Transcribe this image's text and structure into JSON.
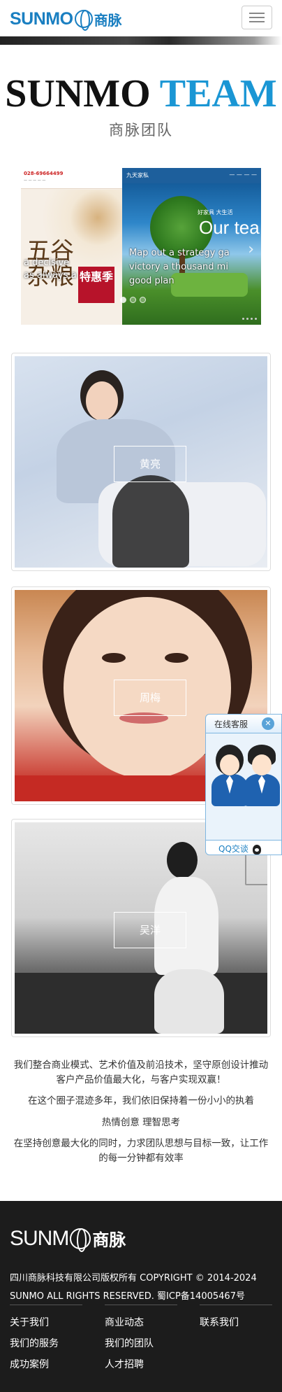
{
  "header": {
    "logo_text": "SUNMO",
    "logo_cn": "商脉",
    "menu_icon": "hamburger-icon"
  },
  "hero": {
    "title_part1": "SUNMO",
    "title_part2": "TEAM",
    "subtitle": "商脉团队"
  },
  "slider": {
    "left_slide": {
      "phone": "028-69664499",
      "big_text": "五谷\n杂粮",
      "badge_text": "特惠季",
      "caption": "a decisive\nas always a"
    },
    "right_slide": {
      "brand": "九天家私",
      "tagline": "好家具 大生活",
      "headline": "Our tea",
      "caption": "Map out a strategy ga\nvictory a thousand mi\ngood plan"
    },
    "arrow_icon": "chevron-right-icon",
    "active_dot": 0,
    "dot_count": 3
  },
  "team": [
    {
      "name": "黄亮"
    },
    {
      "name": "周梅"
    },
    {
      "name": "吴洋"
    }
  ],
  "about": [
    "我们整合商业模式、艺术价值及前沿技术，坚守原创设计推动客户产品价值最大化，与客户实现双赢！",
    "在这个圈子混迹多年，我们依旧保持着一份小小的执着",
    "热情创意 理智思考",
    "在坚持创意最大化的同时，力求团队思想与目标一致，让工作的每一分钟都有效率"
  ],
  "footer": {
    "logo_text": "SUNM",
    "logo_cn": "商脉",
    "copyright_line1": "四川商脉科技有限公司版权所有 COPYRIGHT © 2014-2024",
    "copyright_line2": "SUNMO ALL RIGHTS RESERVED. 蜀ICP备14005467号",
    "columns": [
      [
        "关于我们",
        "我们的服务",
        "成功案例"
      ],
      [
        "商业动态",
        "我们的团队",
        "人才招聘"
      ],
      [
        "联系我们"
      ]
    ]
  },
  "customer_service": {
    "title": "在线客服",
    "qq_label": "QQ交谈"
  },
  "colors": {
    "brand_blue": "#1a7fc1",
    "team_blue": "#1a96d4",
    "footer_bg": "#1c1c1c"
  }
}
